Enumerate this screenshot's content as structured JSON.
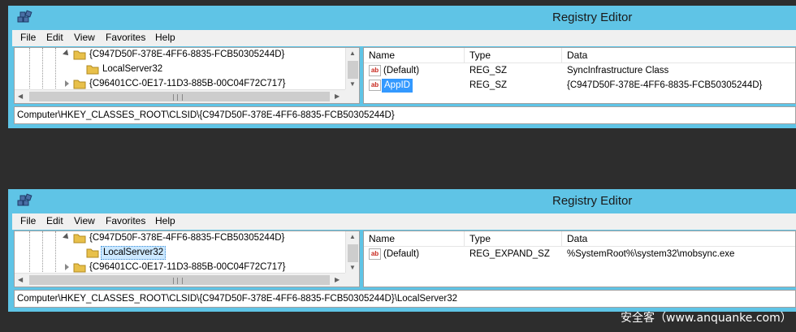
{
  "windows": [
    {
      "title": "Registry Editor",
      "menu": [
        "File",
        "Edit",
        "View",
        "Favorites",
        "Help"
      ],
      "tree": [
        {
          "label": "{C947D50F-378E-4FF6-8835-FCB50305244D}",
          "expanded": true,
          "selected": false
        },
        {
          "label": "LocalServer32",
          "expanded": null,
          "selected": false
        },
        {
          "label": "{C96401CC-0E17-11D3-885B-00C04F72C717}",
          "expanded": false,
          "selected": false
        }
      ],
      "columns": [
        "Name",
        "Type",
        "Data"
      ],
      "values": [
        {
          "icon": "ab",
          "name": "(Default)",
          "type": "REG_SZ",
          "data": "SyncInfrastructure Class",
          "selected": false
        },
        {
          "icon": "ab",
          "name": "AppID",
          "type": "REG_SZ",
          "data": "{C947D50F-378E-4FF6-8835-FCB50305244D}",
          "selected": true
        }
      ],
      "status_path": "Computer\\HKEY_CLASSES_ROOT\\CLSID\\{C947D50F-378E-4FF6-8835-FCB50305244D}"
    },
    {
      "title": "Registry Editor",
      "menu": [
        "File",
        "Edit",
        "View",
        "Favorites",
        "Help"
      ],
      "tree": [
        {
          "label": "{C947D50F-378E-4FF6-8835-FCB50305244D}",
          "expanded": true,
          "selected": false
        },
        {
          "label": "LocalServer32",
          "expanded": null,
          "selected": true
        },
        {
          "label": "{C96401CC-0E17-11D3-885B-00C04F72C717}",
          "expanded": false,
          "selected": false
        }
      ],
      "columns": [
        "Name",
        "Type",
        "Data"
      ],
      "values": [
        {
          "icon": "ab",
          "name": "(Default)",
          "type": "REG_EXPAND_SZ",
          "data": "%SystemRoot%\\system32\\mobsync.exe",
          "selected": false
        }
      ],
      "status_path": "Computer\\HKEY_CLASSES_ROOT\\CLSID\\{C947D50F-378E-4FF6-8835-FCB50305244D}\\LocalServer32"
    }
  ],
  "scrollbar": {
    "grip": "III",
    "up": "▲",
    "down": "▼",
    "left": "◀",
    "right": "▶"
  },
  "watermark": "安全客（www.anquanke.com）",
  "colors": {
    "titlebar": "#5fc4e6",
    "selection": "#3399ff",
    "tree_selection": "#cce8ff",
    "background": "#2d2d2d"
  }
}
